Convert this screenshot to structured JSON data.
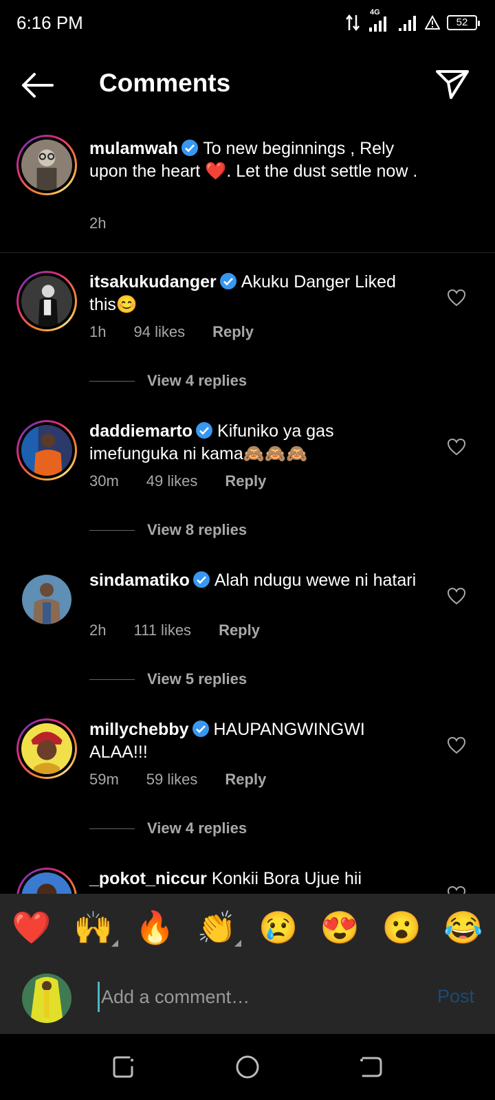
{
  "status_bar": {
    "time": "6:16 PM",
    "network": "4G",
    "battery": "52"
  },
  "header": {
    "title": "Comments"
  },
  "caption": {
    "username": "mulamwah",
    "text": "To new beginnings , Rely upon the heart ❤️. Let the dust settle now .",
    "time": "2h"
  },
  "comments": [
    {
      "username": "itsakukudanger",
      "text": "Akuku Danger Liked this😊",
      "time": "1h",
      "likes": "94 likes",
      "reply": "Reply",
      "view_replies": "View 4 replies"
    },
    {
      "username": "daddiemarto",
      "text": "Kifuniko ya gas imefunguka ni kama🙈🙈🙈",
      "time": "30m",
      "likes": "49 likes",
      "reply": "Reply",
      "view_replies": "View 8 replies"
    },
    {
      "username": "sindamatiko",
      "text": "Alah ndugu wewe ni hatari",
      "time": "2h",
      "likes": "111 likes",
      "reply": "Reply",
      "view_replies": "View 5 replies"
    },
    {
      "username": "millychebby",
      "text": "HAUPANGWINGWI ALAA!!!",
      "time": "59m",
      "likes": "59 likes",
      "reply": "Reply",
      "view_replies": "View 4 replies"
    },
    {
      "username": "_pokot_niccur",
      "text": "Konkii Bora Ujue hii"
    }
  ],
  "emoji_bar": [
    "❤️",
    "🙌",
    "🔥",
    "👏",
    "😢",
    "😍",
    "😮",
    "😂"
  ],
  "composer": {
    "placeholder": "Add a comment…",
    "post_label": "Post"
  },
  "colors": {
    "verified": "#3897f0",
    "post_disabled": "#1b4a78",
    "secondary_text": "#a8a8a8"
  }
}
